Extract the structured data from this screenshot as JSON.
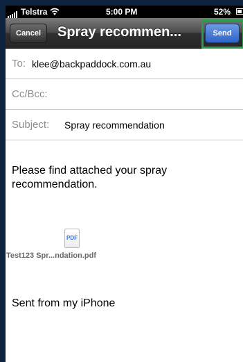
{
  "status_bar": {
    "carrier": "Telstra",
    "time": "5:00 PM",
    "battery_percent": "52%",
    "battery_level": 0.52,
    "icons": [
      "signal-icon",
      "wifi-icon",
      "battery-icon"
    ]
  },
  "nav": {
    "cancel_label": "Cancel",
    "title": "Spray recommen...",
    "send_label": "Send",
    "highlight_color": "#2e9a4b"
  },
  "fields": {
    "to_label": "To:",
    "to_value": "klee@backpaddock.com.au",
    "cc_label": "Cc/Bcc:",
    "subject_label": "Subject:",
    "subject_value": "Spray recommendation"
  },
  "body": {
    "message": "Please find attached your spray recommendation.",
    "attachment_icon_text": "PDF",
    "attachment_name": "Test123 Spr...ndation.pdf",
    "signature": "Sent from my iPhone"
  }
}
